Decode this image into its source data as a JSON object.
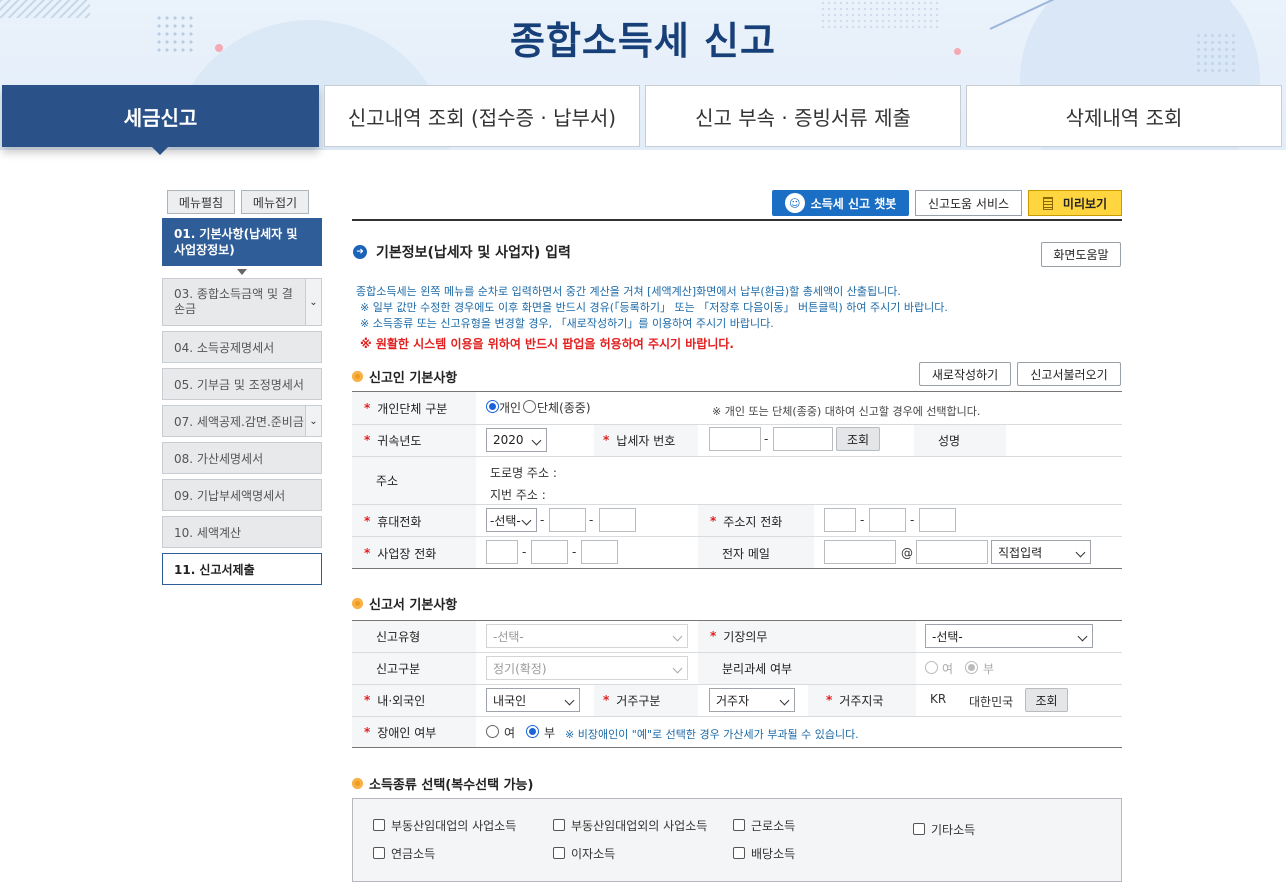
{
  "header": {
    "title": "종합소득세 신고"
  },
  "tabs": [
    {
      "label": "세금신고"
    },
    {
      "label": "신고내역 조회 (접수증 · 납부서)"
    },
    {
      "label": "신고 부속 · 증빙서류 제출"
    },
    {
      "label": "삭제내역 조회"
    }
  ],
  "sidebar": {
    "expand_label": "메뉴펼침",
    "collapse_label": "메뉴접기",
    "items": [
      {
        "label": "01. 기본사항(납세자 및 사업장정보)"
      },
      {
        "label": "03. 종합소득금액 및 결손금"
      },
      {
        "label": "04. 소득공제명세서"
      },
      {
        "label": "05. 기부금 및 조정명세서"
      },
      {
        "label": "07. 세액공제.감면.준비금"
      },
      {
        "label": "08. 가산세명세서"
      },
      {
        "label": "09. 기납부세액명세서"
      },
      {
        "label": "10. 세액계산"
      },
      {
        "label": "11. 신고서제출"
      }
    ]
  },
  "toolbar": {
    "chatbot_label": "소득세 신고 챗봇",
    "help_service_label": "신고도움 서비스",
    "preview_label": "미리보기"
  },
  "basic": {
    "section_title": "기본정보(납세자 및 사업자) 입력",
    "screen_help_label": "화면도움말",
    "notices": [
      "종합소득세는 왼쪽 메뉴를 순차로 입력하면서 중간 계산을 거쳐 [세액계산]화면에서 납부(환급)할 총세액이 산출됩니다.",
      "※ 일부 값만 수정한 경우에도 이후 화면을 반드시 경유(「등록하기」 또는 「저장후 다음이동」 버튼클릭) 하여 주시기 바랍니다.",
      "※ 소득종류 또는 신고유형을 변경할 경우, 「새로작성하기」를 이용하여 주시기 바랍니다."
    ],
    "popup_notice": "※ 원활한 시스템 이용을 위하여 반드시 팝업을 허용하여 주시기 바랍니다."
  },
  "reporter": {
    "section_title": "신고인 기본사항",
    "new_write_label": "새로작성하기",
    "load_label": "신고서불러오기",
    "type_label": "개인단체 구분",
    "type_individual": "개인",
    "type_group": "단체(종중)",
    "type_note": "※ 개인 또는 단체(종중) 대하여 신고할 경우에 선택합니다.",
    "year_label": "귀속년도",
    "year_value": "2020",
    "taxpayer_no_label": "납세자 번호",
    "lookup_label": "조회",
    "name_label": "성명",
    "address_label": "주소",
    "road_address_label": "도로명 주소 :",
    "lot_address_label": "지번 주소 :",
    "mobile_label": "휴대전화",
    "mobile_select": "-선택-",
    "home_phone_label": "주소지 전화",
    "office_phone_label": "사업장 전화",
    "email_label": "전자 메일",
    "email_at": "@",
    "email_domain": "직접입력",
    "dash": "-"
  },
  "report_basic": {
    "section_title": "신고서 기본사항",
    "report_type_label": "신고유형",
    "report_type_value": "-선택-",
    "bookkeeping_label": "기장의무",
    "bookkeeping_value": "-선택-",
    "report_kind_label": "신고구분",
    "report_kind_value": "정기(확정)",
    "separate_tax_label": "분리과세 여부",
    "yes_label": "여",
    "no_label": "부",
    "nationality_label": "내·외국인",
    "nationality_value": "내국인",
    "residence_label": "거주구분",
    "residence_value": "거주자",
    "residence_country_label": "거주지국",
    "country_code": "KR",
    "country_name": "대한민국",
    "lookup_label": "조회",
    "disability_label": "장애인 여부",
    "disability_note": "※ 비장애인이 \"예\"로 선택한 경우 가산세가 부과될 수 있습니다."
  },
  "income_types": {
    "section_title": "소득종류 선택(복수선택 가능)",
    "options": [
      "부동산임대업의 사업소득",
      "부동산임대업외의 사업소득",
      "근로소득",
      "기타소득",
      "연금소득",
      "이자소득",
      "배당소득"
    ]
  },
  "colors": {
    "brand": "#2a5289",
    "chatbot": "#1a6ec4",
    "warning": "#e1201f",
    "notice": "#1c6aa8"
  }
}
